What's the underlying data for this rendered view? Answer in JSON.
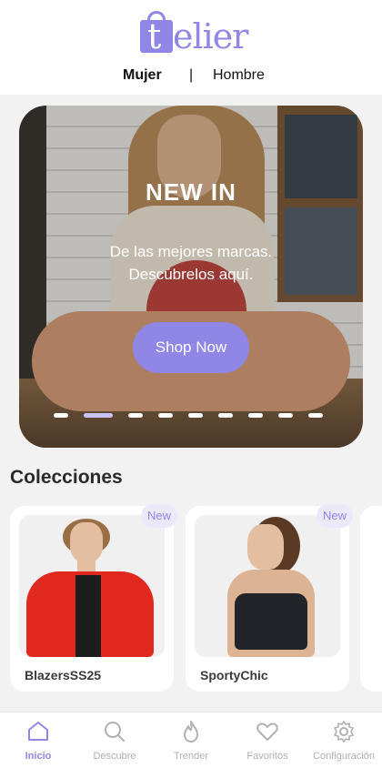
{
  "header": {
    "logo_t": "t",
    "logo_rest": "elier",
    "tabs": [
      "Mujer",
      "Hombre"
    ],
    "divider": "|"
  },
  "hero": {
    "title": "NEW IN",
    "subtitle_line1": "De las mejores marcas.",
    "subtitle_line2": "Descúbrelos aquí.",
    "button": "Shop Now",
    "slides_total": 9,
    "active_slide": 2
  },
  "collections": {
    "title": "Colecciones",
    "items": [
      {
        "label": "BlazersSS25",
        "badge": "New"
      },
      {
        "label": "SportyChic",
        "badge": "New"
      }
    ]
  },
  "nav": {
    "items": [
      {
        "label": "Inicio",
        "icon": "home-icon",
        "active": true
      },
      {
        "label": "Descubre",
        "icon": "search-icon",
        "active": false
      },
      {
        "label": "Trender",
        "icon": "flame-icon",
        "active": false
      },
      {
        "label": "Favoritos",
        "icon": "heart-icon",
        "active": false
      },
      {
        "label": "Configuración",
        "icon": "gear-icon",
        "active": false
      }
    ]
  },
  "colors": {
    "accent": "#8f86e6",
    "badge_bg": "#ebe8f9",
    "inactive": "#b0b0b0"
  }
}
